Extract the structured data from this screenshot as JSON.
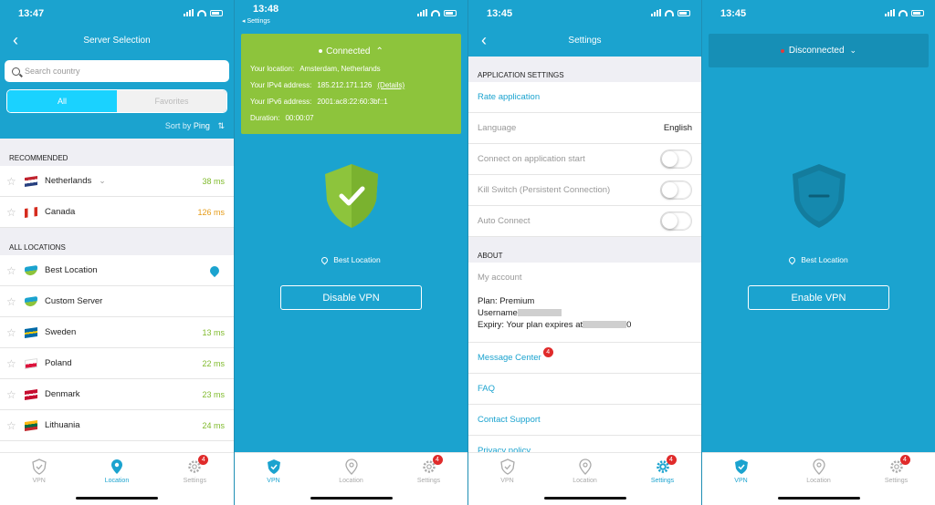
{
  "colors": {
    "brand": "#1ba3cf",
    "connected": "#8dc43c",
    "badge": "#e02b2b"
  },
  "tabs": {
    "vpn": "VPN",
    "location": "Location",
    "settings": "Settings",
    "badge_count": "4"
  },
  "p1": {
    "time": "13:47",
    "title": "Server Selection",
    "search_placeholder": "Search country",
    "seg_all": "All",
    "seg_favorites": "Favorites",
    "sort_by": "Sort by",
    "sort_value": "Ping",
    "recommended": "RECOMMENDED",
    "all_locations": "ALL LOCATIONS",
    "recommended_rows": [
      {
        "name": "Netherlands",
        "ping": "38 ms"
      },
      {
        "name": "Canada",
        "ping": "126 ms"
      }
    ],
    "location_rows": [
      {
        "name": "Best Location",
        "ping": ""
      },
      {
        "name": "Custom Server",
        "ping": ""
      },
      {
        "name": "Sweden",
        "ping": "13 ms"
      },
      {
        "name": "Poland",
        "ping": "22 ms"
      },
      {
        "name": "Denmark",
        "ping": "23 ms"
      },
      {
        "name": "Lithuania",
        "ping": "24 ms"
      }
    ]
  },
  "p2": {
    "time": "13:48",
    "back_app": "◂ Settings",
    "status": "Connected",
    "location_label": "Your location:",
    "location_value": "Amsterdam, Netherlands",
    "ipv4_label": "Your IPv4 address:",
    "ipv4_value": "185.212.171.126",
    "details": "(Details)",
    "ipv6_label": "Your IPv6 address:",
    "ipv6_value": "2001:ac8:22:60:3bf::1",
    "duration_label": "Duration:",
    "duration_value": "00:00:07",
    "best_location": "Best Location",
    "button": "Disable VPN"
  },
  "p3": {
    "time": "13:45",
    "title": "Settings",
    "app_settings": "APPLICATION SETTINGS",
    "rate": "Rate application",
    "language": "Language",
    "language_value": "English",
    "connect_start": "Connect on application start",
    "kill_switch": "Kill Switch (Persistent Connection)",
    "auto_connect": "Auto Connect",
    "about": "ABOUT",
    "my_account": "My account",
    "plan": "Plan: Premium",
    "username": "Username",
    "expiry": "Expiry: Your plan expires at",
    "expiry_tail": "0",
    "message_center": "Message Center",
    "faq": "FAQ",
    "contact": "Contact Support",
    "privacy": "Privacy policy"
  },
  "p4": {
    "time": "13:45",
    "status": "Disconnected",
    "best_location": "Best Location",
    "button": "Enable VPN"
  }
}
